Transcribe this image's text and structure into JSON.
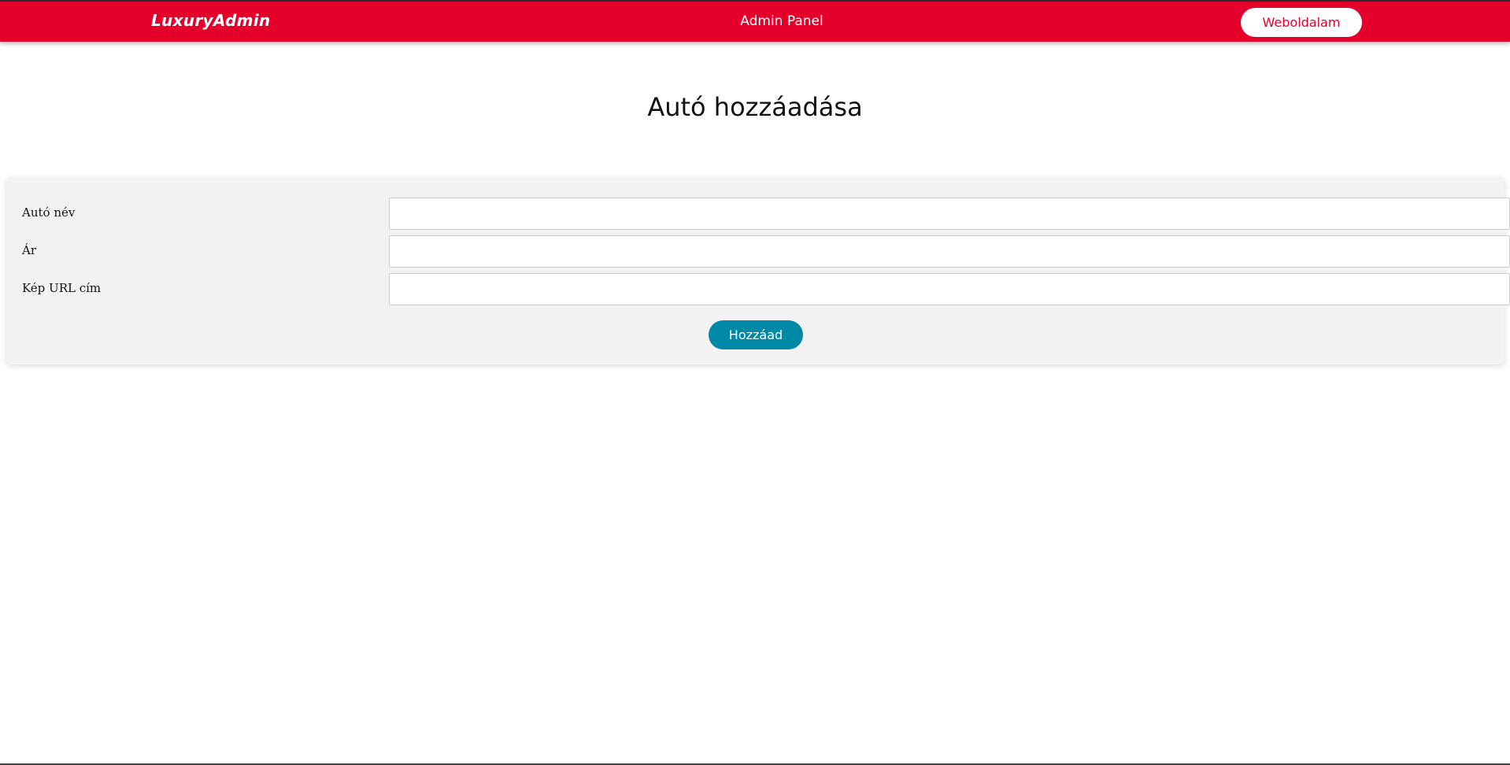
{
  "header": {
    "brand": "LuxuryAdmin",
    "title": "Admin Panel",
    "site_button_label": "Weboldalam"
  },
  "page": {
    "title": "Autó hozzáadása"
  },
  "form": {
    "fields": [
      {
        "label": "Autó név",
        "value": ""
      },
      {
        "label": "Ár",
        "value": ""
      },
      {
        "label": "Kép URL cím",
        "value": ""
      }
    ],
    "submit_label": "Hozzáad"
  },
  "colors": {
    "header_background": "#e4002b",
    "submit_button": "#0089a7",
    "card_background": "#f2f2f2"
  }
}
